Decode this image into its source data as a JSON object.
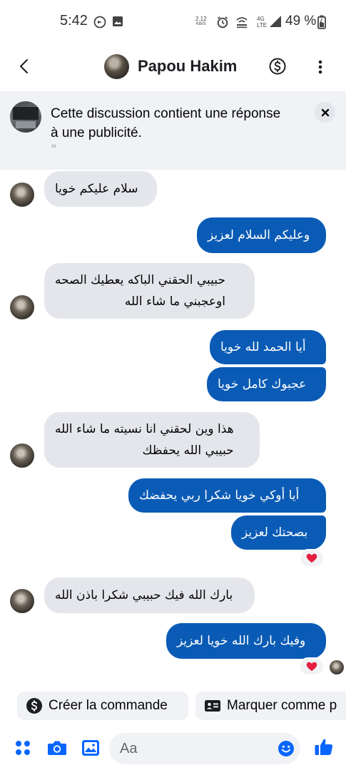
{
  "status_bar": {
    "time": "5:42",
    "net_speed_value": "2.12",
    "net_speed_unit": "KB/S",
    "network_type": "4G",
    "lte": "LTE",
    "battery": "49 %"
  },
  "header": {
    "contact_name": "Papou Hakim"
  },
  "banner": {
    "text": "Cette discussion contient une réponse à une publicité.",
    "sub": "ווו"
  },
  "messages": [
    {
      "dir": "in",
      "lines": [
        "سلام عليكم خويا"
      ]
    },
    {
      "dir": "out",
      "lines": [
        "وعليكم السلام لعزيز"
      ]
    },
    {
      "dir": "in",
      "lines": [
        "حبيبي الحقني الباكه يعطيك الصحه",
        "اوعجبني ما شاء الله"
      ]
    },
    {
      "dir": "out",
      "lines": [
        "أيا الحمد لله خويا"
      ]
    },
    {
      "dir": "out",
      "lines": [
        "عجبوك كامل خويا"
      ]
    },
    {
      "dir": "in",
      "lines": [
        "هذا وين لحقني انا نسيته ما شاء الله",
        "حبيبي الله يحفظك"
      ]
    },
    {
      "dir": "out",
      "lines": [
        "أيا أوكي خويا شكرا ربي يحفضك"
      ]
    },
    {
      "dir": "out",
      "lines": [
        "بصحتك لعزيز"
      ],
      "reaction": "heart"
    },
    {
      "dir": "in",
      "lines": [
        "بارك الله فيك حبيبي شكرا باذن الله"
      ]
    },
    {
      "dir": "out",
      "lines": [
        "وفيك بارك الله خويا لعزيز"
      ],
      "reaction": "heart"
    }
  ],
  "quick_actions": {
    "create_order": "Créer la commande",
    "mark_as": "Marquer comme p"
  },
  "composer": {
    "placeholder": "Aa"
  },
  "colors": {
    "sent_bubble": "#0a5bb5",
    "received_bubble": "#e4e6eb",
    "accent": "#0866ff",
    "reaction_heart": "#e41e3f"
  },
  "icons": [
    "back-arrow-icon",
    "dollar-circle-icon",
    "more-vertical-icon",
    "close-icon",
    "heart-icon",
    "menu-grid-icon",
    "camera-icon",
    "gallery-icon",
    "emoji-icon",
    "like-thumb-icon",
    "id-card-icon"
  ]
}
